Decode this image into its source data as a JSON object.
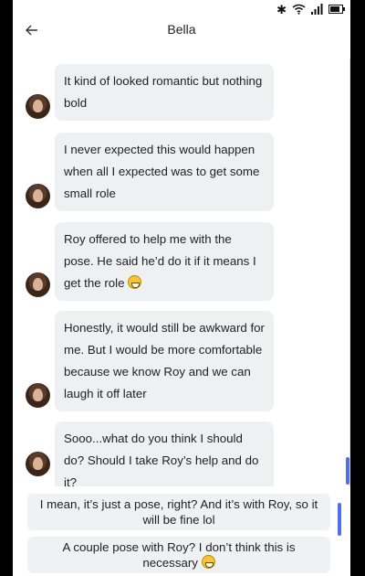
{
  "chat": {
    "title": "Bella"
  },
  "messages": [
    {
      "text": "It kind of looked romantic but nothing bold",
      "emoji": false
    },
    {
      "text": "I never expected this would happen when all I expected was to get some small role",
      "emoji": false
    },
    {
      "text": "Roy offered to help me with the pose. He said he’d do it if it means I get the role",
      "emoji": true
    },
    {
      "text": "Honestly, it would still be awkward for me. But I would be more comfortable because we know Roy and we can laugh it off later",
      "emoji": false
    },
    {
      "text": "Sooo...what do you think I should do? Should I take Roy’s help and do it?",
      "emoji": false
    }
  ],
  "choices": [
    {
      "text": "I mean, it’s just a pose, right? And it’s with Roy, so it will be fine lol",
      "emoji": false
    },
    {
      "text": "A couple pose with Roy? I don’t think this is necessary",
      "emoji": true
    }
  ],
  "colors": {
    "bubble": "#eef0f2",
    "accent": "#4f6ff0",
    "choice": "#f0f1f3"
  },
  "icons": {
    "back": "arrow-left-icon",
    "bluetooth": "bluetooth-icon",
    "wifi": "wifi-icon",
    "signal": "signal-icon",
    "battery": "battery-icon"
  }
}
